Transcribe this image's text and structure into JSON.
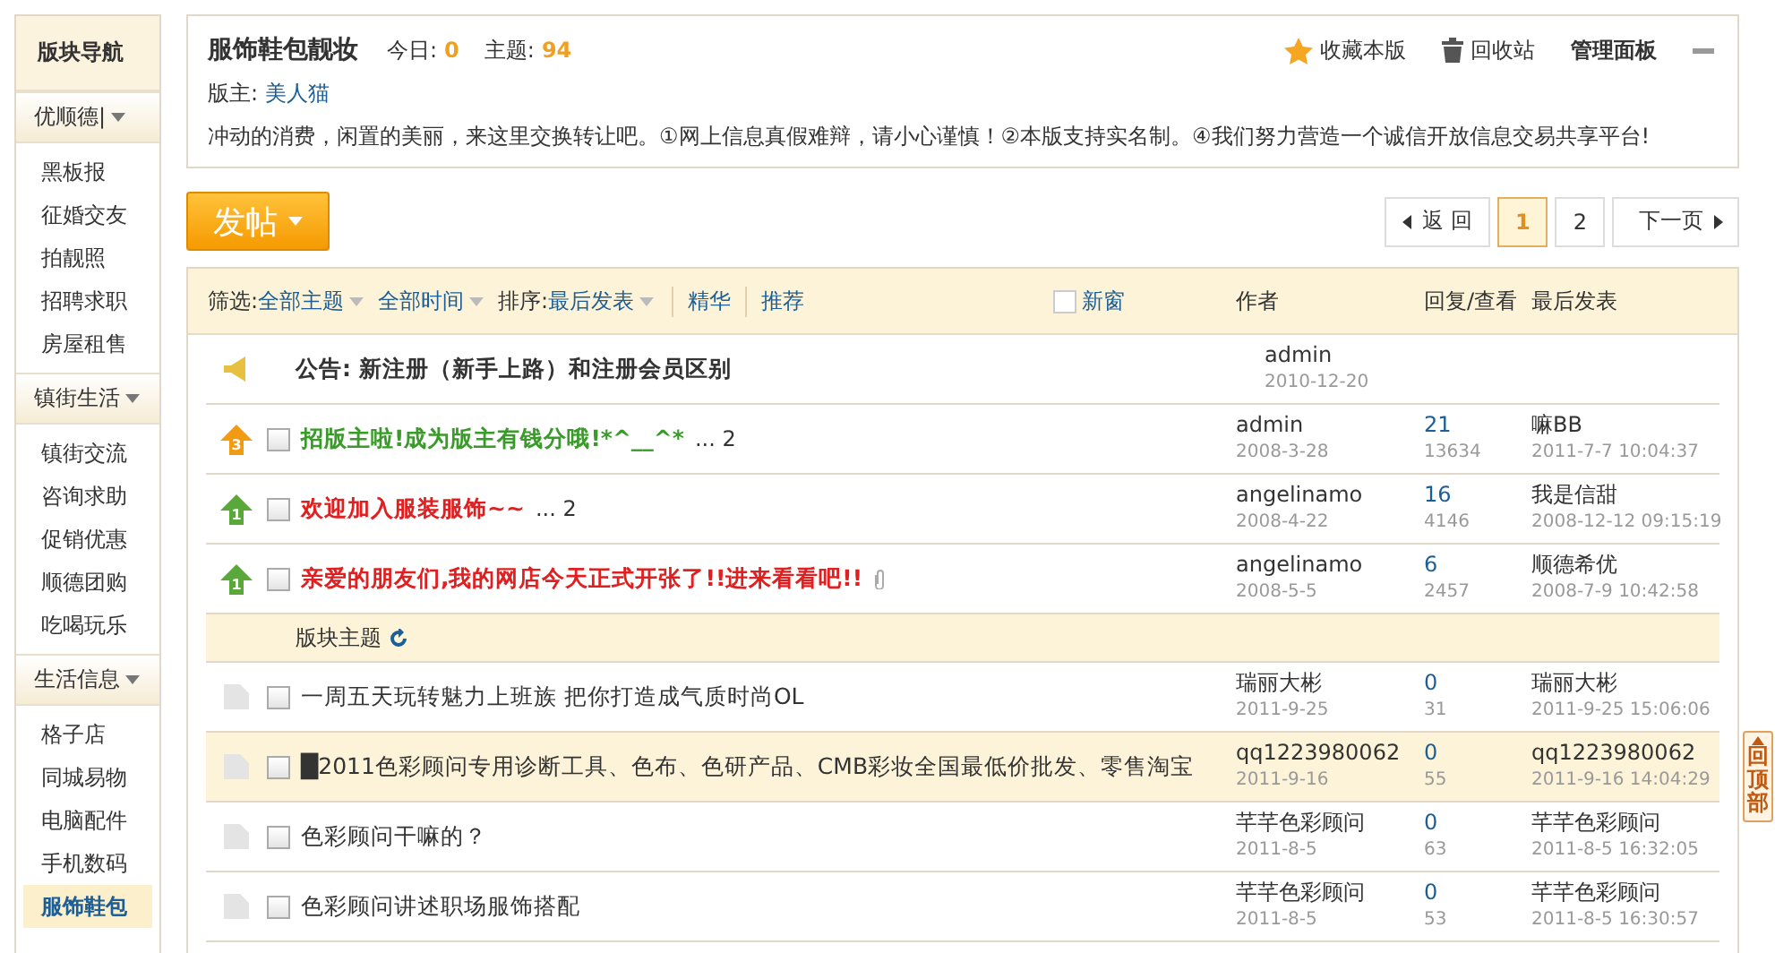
{
  "sidebar": {
    "title": "版块导航",
    "groups": [
      {
        "label": "优顺德|",
        "items": [
          {
            "label": "黑板报",
            "selected": false
          },
          {
            "label": "征婚交友",
            "selected": false
          },
          {
            "label": "拍靓照",
            "selected": false
          },
          {
            "label": "招聘求职",
            "selected": false
          },
          {
            "label": "房屋租售",
            "selected": false
          }
        ]
      },
      {
        "label": "镇街生活",
        "items": [
          {
            "label": "镇街交流",
            "selected": false
          },
          {
            "label": "咨询求助",
            "selected": false
          },
          {
            "label": "促销优惠",
            "selected": false
          },
          {
            "label": "顺德团购",
            "selected": false
          },
          {
            "label": "吃喝玩乐",
            "selected": false
          }
        ]
      },
      {
        "label": "生活信息",
        "items": [
          {
            "label": "格子店",
            "selected": false
          },
          {
            "label": "同城易物",
            "selected": false
          },
          {
            "label": "电脑配件",
            "selected": false
          },
          {
            "label": "手机数码",
            "selected": false
          },
          {
            "label": "服饰鞋包",
            "selected": true
          }
        ]
      }
    ]
  },
  "forum": {
    "title": "服饰鞋包靓妆",
    "today_label": "今日:",
    "today": "0",
    "topics_label": "主题:",
    "topics": "94",
    "moderator_label": "版主:",
    "moderator": "美人猫",
    "actions": [
      {
        "kind": "favorite",
        "label": "收藏本版"
      },
      {
        "kind": "trash",
        "label": "回收站"
      },
      {
        "kind": "admin",
        "label": "管理面板"
      }
    ],
    "description": "冲动的消费，闲置的美丽，来这里交换转让吧。①网上信息真假难辩，请小心谨慎！②本版支持实名制。④我们努力营造一个诚信开放信息交易共享平台!"
  },
  "post_button": "发帖",
  "pagination": {
    "back": "返 回",
    "pages": [
      {
        "label": "1",
        "selected": true
      },
      {
        "label": "2",
        "selected": false
      }
    ],
    "next": "下一页"
  },
  "filters": {
    "label": "筛选:",
    "type": "全部主题",
    "time": "全部时间",
    "sort_label": "排序:",
    "sort": "最后发表",
    "links": [
      "精华",
      "推荐"
    ],
    "new_window": {
      "label": "新窗",
      "checked": false
    }
  },
  "columns": {
    "author": "作者",
    "replies": "回复/查看",
    "last": "最后发表"
  },
  "threads": [
    {
      "kind": "announcement",
      "title": "公告: 新注册（新手上路）和注册会员区别",
      "author": "admin",
      "date": "2010-12-20"
    },
    {
      "kind": "sticky",
      "badge": {
        "level": "3",
        "color": "#f29a12"
      },
      "title": "招版主啦!成为版主有钱分哦!*^__^*",
      "color": "#3a9a2a",
      "pages": "... 2",
      "checked": false,
      "attachment": false,
      "author": "admin",
      "date": "2008-3-28",
      "replies": "21",
      "views": "13634",
      "last_user": "嘛BB",
      "last_time": "2011-7-7 10:04:37",
      "highlighted": false
    },
    {
      "kind": "sticky",
      "badge": {
        "level": "1",
        "color": "#5aa83a"
      },
      "title": "欢迎加入服装服饰~~",
      "color": "#e02020",
      "pages": "... 2",
      "checked": false,
      "attachment": false,
      "author": "angelinamo",
      "date": "2008-4-22",
      "replies": "16",
      "views": "4146",
      "last_user": "我是信甜",
      "last_time": "2008-12-12 09:15:19",
      "highlighted": false
    },
    {
      "kind": "sticky",
      "badge": {
        "level": "1",
        "color": "#5aa83a"
      },
      "title": "亲爱的朋友们,我的网店今天正式开张了!!进来看看吧!!",
      "color": "#e02020",
      "checked": false,
      "attachment": true,
      "author": "angelinamo",
      "date": "2008-5-5",
      "replies": "6",
      "views": "2457",
      "last_user": "顺德希优",
      "last_time": "2008-7-9 10:42:58",
      "highlighted": false
    },
    {
      "kind": "separator",
      "title": "版块主题"
    },
    {
      "kind": "normal",
      "title": "一周五天玩转魅力上班族 把你打造成气质时尚OL",
      "checked": false,
      "attachment": false,
      "author": "瑞丽大彬",
      "date": "2011-9-25",
      "replies": "0",
      "views": "31",
      "last_user": "瑞丽大彬",
      "last_time": "2011-9-25 15:06:06",
      "highlighted": false
    },
    {
      "kind": "normal",
      "title": "█2011色彩顾问专用诊断工具、色布、色研产品、CMB彩妆全国最低价批发、零售淘宝",
      "checked": false,
      "attachment": false,
      "author": "qq1223980062",
      "date": "2011-9-16",
      "replies": "0",
      "views": "55",
      "last_user": "qq1223980062",
      "last_time": "2011-9-16 14:04:29",
      "highlighted": true
    },
    {
      "kind": "normal",
      "title": "色彩顾问干嘛的？",
      "checked": false,
      "attachment": false,
      "author": "芊芊色彩顾问",
      "date": "2011-8-5",
      "replies": "0",
      "views": "63",
      "last_user": "芊芊色彩顾问",
      "last_time": "2011-8-5 16:32:05",
      "highlighted": false
    },
    {
      "kind": "normal",
      "title": "色彩顾问讲述职场服饰搭配",
      "checked": false,
      "attachment": false,
      "author": "芊芊色彩顾问",
      "date": "2011-8-5",
      "replies": "0",
      "views": "53",
      "last_user": "芊芊色彩顾问",
      "last_time": "2011-8-5 16:30:57",
      "highlighted": false
    }
  ],
  "back_to_top": "回顶部"
}
